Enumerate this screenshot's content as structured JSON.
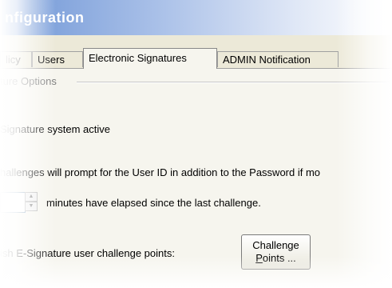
{
  "window": {
    "title": "nfiguration"
  },
  "tabs": [
    {
      "label": "licy"
    },
    {
      "label": "Users"
    },
    {
      "label": "Electronic Signatures"
    },
    {
      "label": "ADMIN Notification"
    }
  ],
  "group": {
    "label": "ture Options"
  },
  "signature_active": "Signature system active",
  "challenge_text": "hallenges will prompt for the User ID in addition to the Password if mo",
  "minutes_text": "minutes have elapsed since the last challenge.",
  "points_text": "ish E-Signature user challenge points:",
  "challenge_button": {
    "line1": "Challenge",
    "line2_underlined": "P",
    "line2_rest": "oints ..."
  }
}
